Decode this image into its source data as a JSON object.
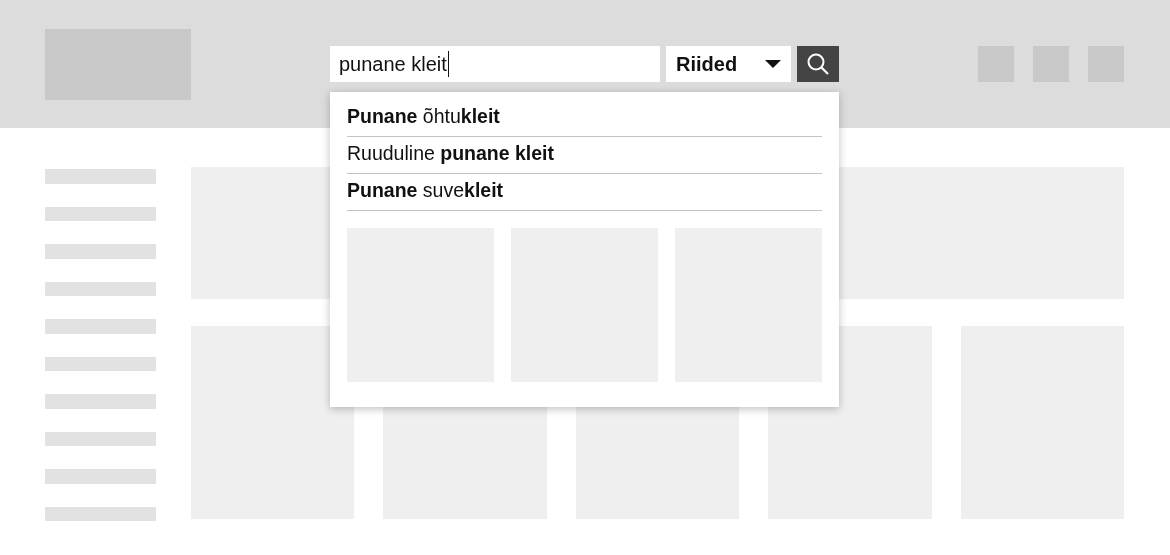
{
  "header": {
    "logo": {
      "kind": "placeholder"
    },
    "search": {
      "value": "punane kleit",
      "focused": true
    },
    "category": {
      "label": "Riided"
    },
    "icons": [
      {
        "kind": "placeholder"
      },
      {
        "kind": "placeholder"
      },
      {
        "kind": "placeholder"
      }
    ]
  },
  "suggestions": [
    {
      "text": "**Punane** õhtu**kleit**"
    },
    {
      "text": "Ruuduline **punane kleit**"
    },
    {
      "text": "**Punane** suve**kleit**"
    }
  ],
  "suggestion_thumbnails": [
    {
      "kind": "placeholder"
    },
    {
      "kind": "placeholder"
    },
    {
      "kind": "placeholder"
    }
  ],
  "sidebar": {
    "items": [
      {
        "kind": "placeholder"
      },
      {
        "kind": "placeholder"
      },
      {
        "kind": "placeholder"
      },
      {
        "kind": "placeholder"
      },
      {
        "kind": "placeholder"
      },
      {
        "kind": "placeholder"
      },
      {
        "kind": "placeholder"
      },
      {
        "kind": "placeholder"
      },
      {
        "kind": "placeholder"
      },
      {
        "kind": "placeholder"
      }
    ]
  },
  "content": {
    "banner": {
      "kind": "placeholder"
    },
    "cards": [
      {
        "kind": "placeholder"
      },
      {
        "kind": "placeholder"
      },
      {
        "kind": "placeholder"
      },
      {
        "kind": "placeholder"
      },
      {
        "kind": "placeholder"
      }
    ]
  }
}
